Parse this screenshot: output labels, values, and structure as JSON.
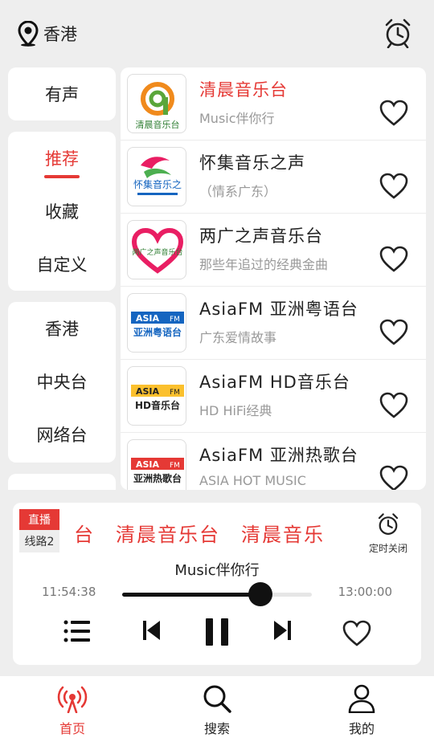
{
  "header": {
    "location": "香港"
  },
  "sidebar": {
    "group1": [
      "有声"
    ],
    "group2": [
      "推荐",
      "收藏",
      "自定义"
    ],
    "group3": [
      "香港",
      "中央台",
      "网络台"
    ],
    "active": "推荐"
  },
  "stations": [
    {
      "name": "清晨音乐台",
      "sub": "Music伴你行",
      "highlighted": true,
      "logo_text": "清晨音乐台"
    },
    {
      "name": "怀集音乐之声",
      "sub": "（情系广东）",
      "highlighted": false,
      "logo_text": "怀集音乐之"
    },
    {
      "name": "两广之声音乐台",
      "sub": "那些年追过的经典金曲",
      "highlighted": false,
      "logo_text": "两广之声音乐台"
    },
    {
      "name": "AsiaFM 亚洲粤语台",
      "sub": "广东爱情故事",
      "highlighted": false,
      "logo_text": "亚洲粤语台"
    },
    {
      "name": "AsiaFM HD音乐台",
      "sub": "HD HiFi经典",
      "highlighted": false,
      "logo_text": "HD音乐台"
    },
    {
      "name": "AsiaFM 亚洲热歌台",
      "sub": "ASIA HOT MUSIC",
      "highlighted": false,
      "logo_text": "亚洲热歌台"
    }
  ],
  "player": {
    "live": "直播",
    "line": "线路2",
    "marquee": "台　清晨音乐台　清晨音乐",
    "timer_label": "定时关闭",
    "subtitle": "Music伴你行",
    "time_current": "11:54:38",
    "time_end": "13:00:00",
    "progress": 0.73
  },
  "nav": {
    "home": "首页",
    "search": "搜索",
    "mine": "我的"
  },
  "colors": {
    "accent": "#e53935",
    "background": "#eeeeee",
    "card": "#ffffff"
  },
  "icons": [
    "location-pin-icon",
    "alarm-clock-icon",
    "heart-icon",
    "playlist-icon",
    "skip-previous-icon",
    "pause-icon",
    "skip-next-icon",
    "radio-broadcast-icon",
    "search-icon",
    "user-icon"
  ]
}
